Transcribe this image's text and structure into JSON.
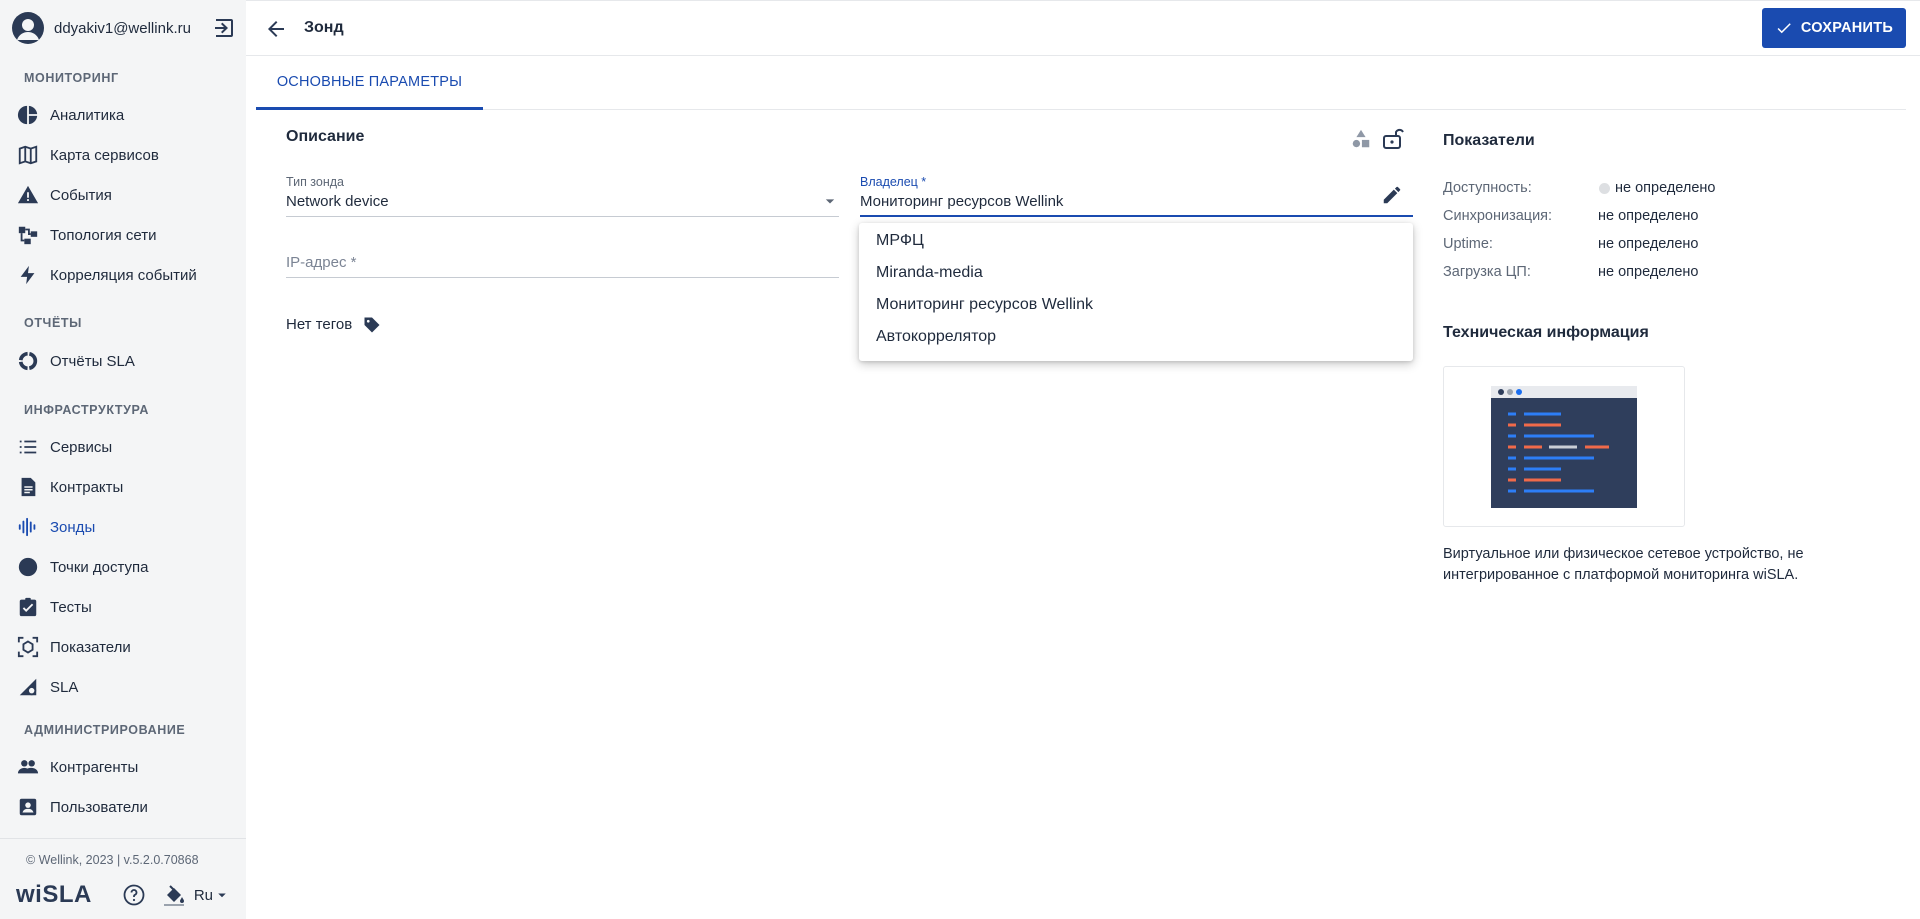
{
  "user": {
    "email": "ddyakiv1@wellink.ru"
  },
  "sidebar": {
    "sections": [
      {
        "title": "МОНИТОРИНГ"
      },
      {
        "title": "ОТЧЁТЫ"
      },
      {
        "title": "ИНФРАСТРУКТУРА"
      },
      {
        "title": "АДМИНИСТРИРОВАНИЕ"
      }
    ],
    "items": [
      {
        "label": "Аналитика",
        "icon": "pie-chart-icon"
      },
      {
        "label": "Карта сервисов",
        "icon": "map-icon"
      },
      {
        "label": "События",
        "icon": "warning-icon"
      },
      {
        "label": "Топология сети",
        "icon": "topology-icon"
      },
      {
        "label": "Корреляция событий",
        "icon": "lightning-icon"
      },
      {
        "label": "Отчёты SLA",
        "icon": "donut-icon"
      },
      {
        "label": "Сервисы",
        "icon": "list-icon"
      },
      {
        "label": "Контракты",
        "icon": "document-icon"
      },
      {
        "label": "Зонды",
        "icon": "probe-icon",
        "active": true
      },
      {
        "label": "Точки доступа",
        "icon": "circle-icon"
      },
      {
        "label": "Тесты",
        "icon": "clipboard-check-icon"
      },
      {
        "label": "Показатели",
        "icon": "metrics-icon"
      },
      {
        "label": "SLA",
        "icon": "sla-icon"
      },
      {
        "label": "Контрагенты",
        "icon": "people-icon"
      },
      {
        "label": "Пользователи",
        "icon": "user-card-icon"
      }
    ],
    "footer": {
      "copyright": "© Wellink, 2023 | v.5.2.0.70868",
      "brand_prefix": "wi",
      "brand_suffix": "SLA",
      "language": "Ru"
    }
  },
  "header": {
    "title": "Зонд",
    "save_label": "СОХРАНИТЬ"
  },
  "tabs": [
    {
      "label": "ОСНОВНЫЕ ПАРАМЕТРЫ",
      "active": true
    }
  ],
  "description": {
    "heading": "Описание",
    "probe_type": {
      "label": "Тип зонда",
      "value": "Network device"
    },
    "owner": {
      "label": "Владелец *",
      "value": "Мониторинг ресурсов Wellink"
    },
    "ip": {
      "placeholder": "IP-адрес *"
    },
    "tags_label": "Нет тегов",
    "owner_options": [
      "МРФЦ",
      "Miranda-media",
      "Мониторинг ресурсов Wellink",
      "Автокоррелятор"
    ]
  },
  "metrics": {
    "heading": "Показатели",
    "rows": [
      {
        "label": "Доступность:",
        "value": "не определено",
        "status_color": "#dddfe2"
      },
      {
        "label": "Синхронизация:",
        "value": "не определено"
      },
      {
        "label": "Uptime:",
        "value": "не определено"
      },
      {
        "label": "Загрузка ЦП:",
        "value": "не определено"
      }
    ]
  },
  "tech_info": {
    "heading": "Техническая информация",
    "description": "Виртуальное или физическое сетевое устройство, не интегрированное с платформой мониторинга wiSLA."
  },
  "colors": {
    "accent": "#1a4bb0",
    "sidebar_bg": "#f4f5f6",
    "icon_dark": "#2b3a55"
  }
}
